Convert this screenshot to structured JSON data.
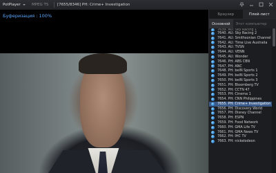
{
  "titlebar": {
    "app_label": "PotPlayer",
    "format": "MPEG TS",
    "title": "[7655/8346] PH: Crime+ Investigation",
    "controls": [
      "pin-icon",
      "minimize-icon",
      "maximize-icon",
      "close-icon"
    ]
  },
  "video": {
    "buffer_text": "Буферизация : 100%"
  },
  "panel": {
    "tabs": [
      {
        "label": "Браузер",
        "active": false
      },
      {
        "label": "Плей-лист",
        "active": true
      }
    ],
    "subtabs": [
      {
        "label": "Основной",
        "active": true
      },
      {
        "label": "Этот компьютер",
        "active": false
      }
    ],
    "items": [
      {
        "label": "7639. AU: Sky Racing 1",
        "clipped": true
      },
      {
        "label": "7640. AU: Sky Racing 2"
      },
      {
        "label": "7641. AU: Smithsonian Channel"
      },
      {
        "label": "7642. AU: Time Live Australia"
      },
      {
        "label": "7643. AU: TVSN"
      },
      {
        "label": "7644. AU: VENN"
      },
      {
        "label": "7645. AU: Wonder"
      },
      {
        "label": "7646. PH: ABS CBN"
      },
      {
        "label": "7647. PH: ANC"
      },
      {
        "label": "7648. PH: beIN Sports 1"
      },
      {
        "label": "7649. PH: beIN Sports 2"
      },
      {
        "label": "7650. PH: beIN Sports 3"
      },
      {
        "label": "7651. PH: Bloomberg TV"
      },
      {
        "label": "7652. PH: CCTN 47"
      },
      {
        "label": "7653. PH: Cinema 1"
      },
      {
        "label": "7654. PH: CNN Philippines"
      },
      {
        "label": "7655. PH: Crime+ Investigation",
        "selected": true
      },
      {
        "label": "7656. PH: Discovery World"
      },
      {
        "label": "7657. PH: Disney Channel"
      },
      {
        "label": "7658. PH: ESPN"
      },
      {
        "label": "7659. PH: Food Network"
      },
      {
        "label": "7660. PH: GMA Life TV"
      },
      {
        "label": "7661. PH: GMA News TV"
      },
      {
        "label": "7662. PH: IHC TV"
      },
      {
        "label": "7663. PH: nickelodeon"
      }
    ]
  },
  "colors": {
    "buffer_text": "#5aa8ff",
    "selected_row": "#3a5a8a",
    "channel_icon": "#2478c8"
  }
}
